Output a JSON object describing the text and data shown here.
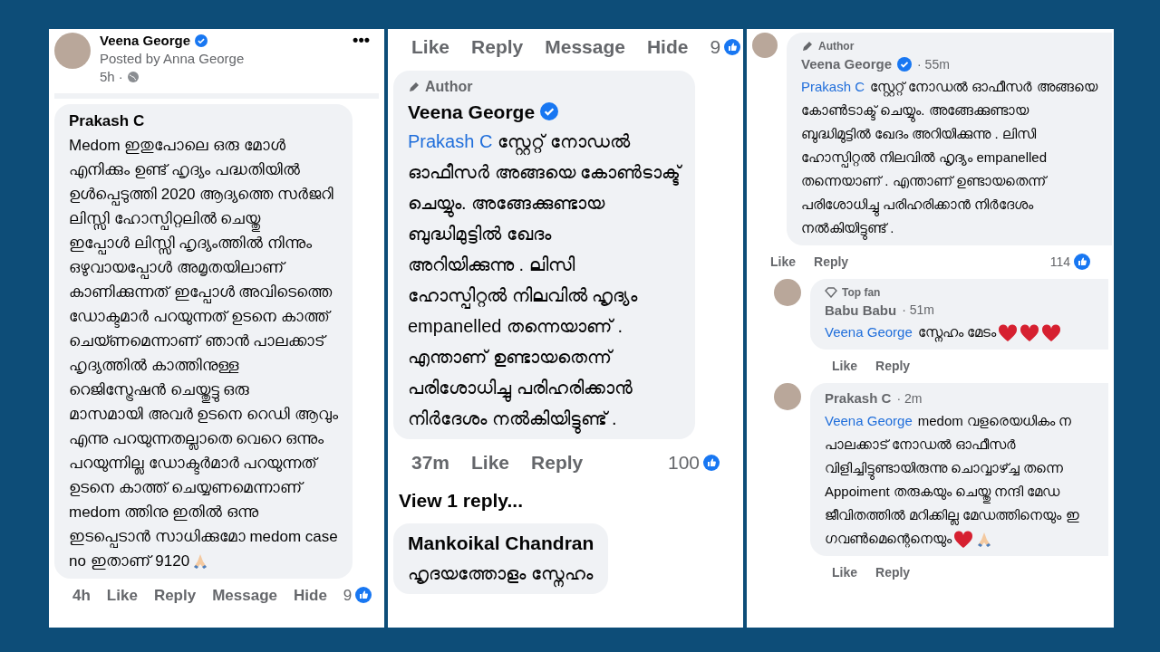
{
  "panels": [
    {
      "kind": "large",
      "items": [
        {
          "kind": "post_header",
          "name": "Veena George",
          "verified": true,
          "posted_by": "Posted by Anna George",
          "time": "5h ·",
          "more": "•••"
        },
        {
          "kind": "comment",
          "name": "Prakash C",
          "lines": [
            "Medom ഇതുപോലെ ഒരു മോൾ",
            "എനിക്കും ഉണ്ട് ഹൃദ്യം പദ്ധതിയിൽ",
            "ഉൾപ്പെടുത്തി 2020 ആദ്യത്തെ സർജറി",
            "ലിസ്സി ഹോസ്പിറ്റലിൽ ചെയ്തു",
            "ഇപ്പോൾ ലിസ്സി ഹൃദ്യംത്തിൽ നിന്നും",
            "ഒഴുവായപ്പോൾ അമൃതയിലാണ്",
            "കാണിക്കുന്നത് ഇപ്പോൾ അവിടെത്തെ",
            "ഡോക്ടമാർ പറയുന്നത് ഉടനെ കാത്ത്",
            "ചെയ്ണമെന്നാണ് ഞാൻ പാലക്കാട്",
            "ഹൃദ്യത്തിൽ കാത്തിനുള്ള",
            "റെജിസ്ട്രേഷൻ ചെയ്തുട്ടു ഒരു",
            "മാസമായി അവർ ഉടനെ റെഡി ആവും",
            "എന്നു പറയുന്നതല്ലാതെ വെറെ ഒന്നും",
            "പറയുന്നില്ല ഡോക്ടർമാർ പറയുന്നത്",
            "ഉടനെ കാത്ത് ചെയ്യണമെന്നാണ്",
            "medom ത്തിനു ഇതിൽ ഒന്നു",
            "ഇടപ്പെടാൻ സാധിക്കുമോ medom case",
            "no ഇതാണ് 9120"
          ],
          "end_icons": [
            {
              "kind": "pray"
            }
          ]
        },
        {
          "kind": "actions",
          "links": [
            "4h",
            "Like",
            "Reply",
            "Message",
            "Hide"
          ],
          "count": "9"
        }
      ]
    },
    {
      "kind": "medium",
      "items": [
        {
          "kind": "actions",
          "links": [
            "Like",
            "Reply",
            "Message",
            "Hide"
          ],
          "count": "9"
        },
        {
          "kind": "comment",
          "badge": {
            "kind": "author",
            "label": "Author"
          },
          "name": "Veena George",
          "verified": true,
          "mention": "Prakash C",
          "lines": [
            "സ്റ്റേറ്റ് നോഡൽ",
            "ഓഫീസർ അങ്ങയെ കോൺടാക്ട്",
            "ചെയ്യും. അങ്ങേക്കുണ്ടായ",
            "ബുദ്ധിമുട്ടിൽ ഖേദം",
            "അറിയിക്കുന്നു . ലിസി",
            "ഹോസ്പിറ്റൽ നിലവിൽ ഹൃദ്യം",
            "empanelled തന്നെയാണ് .",
            "എന്താണ് ഉണ്ടായതെന്ന്",
            "പരിശോധിച്ചു പരിഹരിക്കാൻ",
            "നിർദേശം നൽകിയിട്ടുണ്ട് ."
          ]
        },
        {
          "kind": "actions",
          "links": [
            "37m",
            "Like",
            "Reply"
          ],
          "count": "100"
        },
        {
          "kind": "view_replies",
          "label": "View 1 reply..."
        },
        {
          "kind": "comment",
          "name": "Mankoikal Chandran",
          "lines": [
            "ഹൃദയത്തോളം സ്നേഹം"
          ]
        }
      ]
    },
    {
      "kind": "small",
      "items": [
        {
          "kind": "comment",
          "avatar": true,
          "badge": {
            "kind": "author",
            "label": "Author"
          },
          "name": "Veena George",
          "verified": true,
          "time": "· 55m",
          "mention": "Prakash C",
          "lines": [
            "സ്റ്റേറ്റ് നോഡൽ ഓഫീസർ അങ്ങയെ",
            "കോൺടാക്ട് ചെയ്യും. അങ്ങേക്കുണ്ടായ",
            "ബുദ്ധിമുട്ടിൽ ഖേദം അറിയിക്കുന്നു . ലിസി",
            "ഹോസ്പിറ്റൽ നിലവിൽ ഹൃദ്യം empanelled",
            "തന്നെയാണ് . എന്താണ് ഉണ്ടായതെന്ന്",
            "പരിശോധിച്ചു പരിഹരിക്കാൻ  നിർദേശം",
            "നൽകിയിട്ടുണ്ട് ."
          ]
        },
        {
          "kind": "actions",
          "links": [
            "Like",
            "Reply"
          ],
          "count": "114"
        },
        {
          "kind": "reply",
          "avatar": true,
          "badge": {
            "kind": "top_fan",
            "label": "Top fan"
          },
          "name": "Babu Babu",
          "time": "· 51m",
          "mention": "Veena George",
          "lines": [
            "സ്നേഹം മേടം"
          ],
          "end_icons": [
            {
              "kind": "heart"
            },
            {
              "kind": "heart"
            },
            {
              "kind": "heart"
            }
          ]
        },
        {
          "kind": "reply_actions",
          "links": [
            "Like",
            "Reply"
          ]
        },
        {
          "kind": "reply",
          "avatar": true,
          "name": "Prakash C",
          "time": "· 2m",
          "mention": "Veena George",
          "lines": [
            "medom വളരെയധികം ന",
            "പാലക്കാട് നോഡൽ ഓഫീസർ",
            "വിളിച്ചിട്ടുണ്ടായിരുന്നു ചൊവ്വാഴ്ച്ച തന്നെ",
            "Appoiment തരുകയും ചെയ്തു നന്ദി മേഡ",
            "ജീവിതത്തിൽ മറിക്കില്ല മേഡത്തിനെയും ഇ",
            "ഗവൺമെന്റെനെയും"
          ],
          "end_icons": [
            {
              "kind": "heart"
            },
            {
              "kind": "pray"
            }
          ]
        },
        {
          "kind": "reply_actions",
          "links": [
            "Like",
            "Reply"
          ]
        }
      ]
    }
  ]
}
